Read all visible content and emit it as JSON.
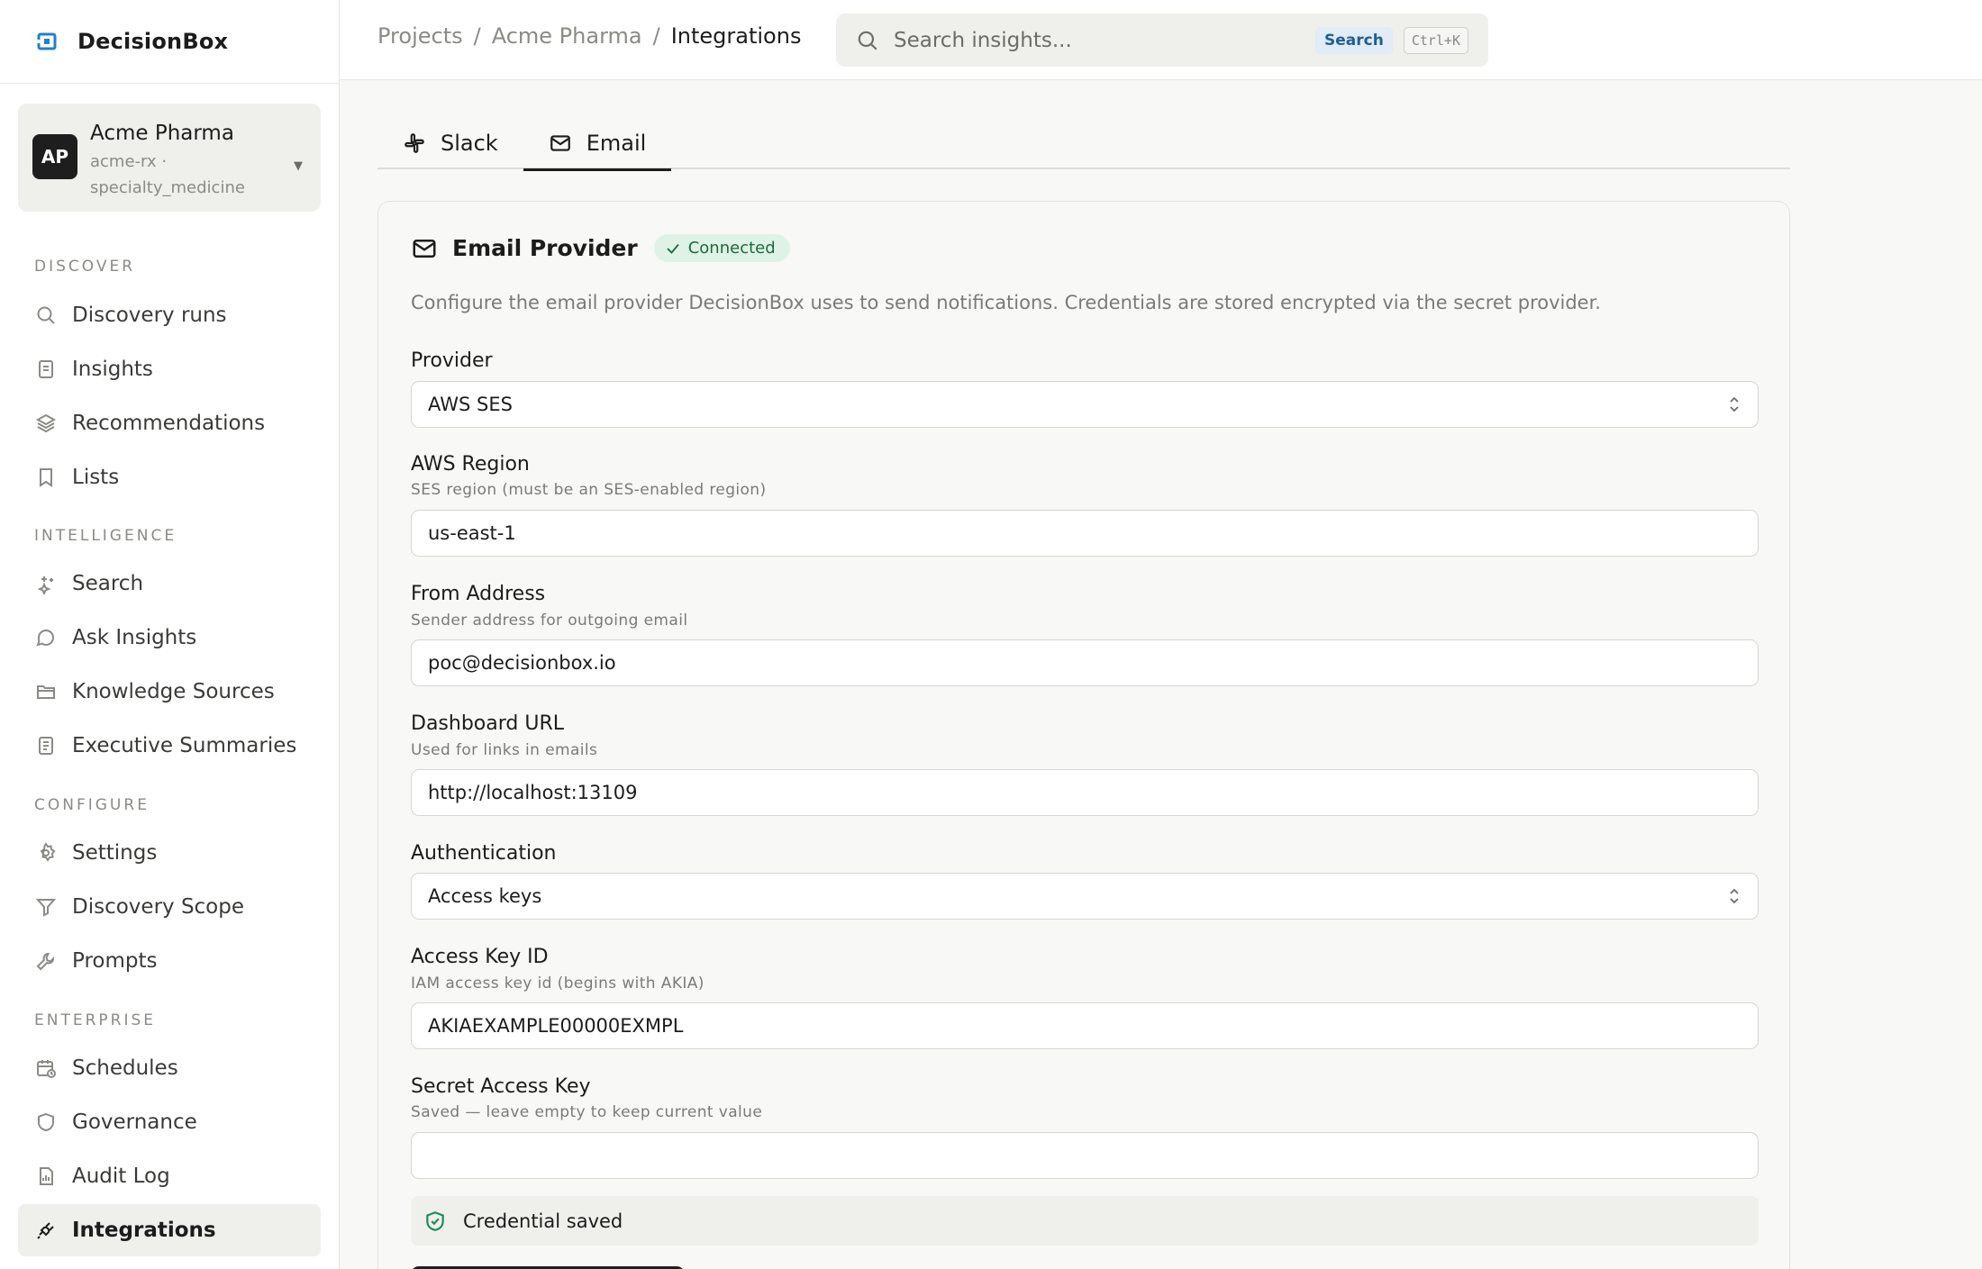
{
  "app": {
    "name": "DecisionBox"
  },
  "project": {
    "initials": "AP",
    "name": "Acme Pharma",
    "subtitle": "acme-rx · specialty_medicine"
  },
  "sidebar": {
    "sections": [
      {
        "title": "DISCOVER",
        "items": [
          "Discovery runs",
          "Insights",
          "Recommendations",
          "Lists"
        ]
      },
      {
        "title": "INTELLIGENCE",
        "items": [
          "Search",
          "Ask Insights",
          "Knowledge Sources",
          "Executive Summaries"
        ]
      },
      {
        "title": "CONFIGURE",
        "items": [
          "Settings",
          "Discovery Scope",
          "Prompts"
        ]
      },
      {
        "title": "ENTERPRISE",
        "items": [
          "Schedules",
          "Governance",
          "Audit Log",
          "Integrations"
        ]
      }
    ],
    "active": "Integrations"
  },
  "breadcrumb": {
    "items": [
      "Projects",
      "Acme Pharma"
    ],
    "current": "Integrations",
    "separator": "/"
  },
  "search": {
    "placeholder": "Search insights...",
    "button": "Search",
    "shortcut": "Ctrl+K"
  },
  "tabs": [
    {
      "label": "Slack",
      "icon": "slack-icon"
    },
    {
      "label": "Email",
      "icon": "mail-icon",
      "active": true
    }
  ],
  "card": {
    "title": "Email Provider",
    "status": "Connected",
    "description": "Configure the email provider DecisionBox uses to send notifications. Credentials are stored encrypted via the secret provider.",
    "fields": {
      "provider": {
        "label": "Provider",
        "value": "AWS SES"
      },
      "region": {
        "label": "AWS Region",
        "hint": "SES region (must be an SES-enabled region)",
        "value": "us-east-1"
      },
      "from": {
        "label": "From Address",
        "hint": "Sender address for outgoing email",
        "value": "poc@decisionbox.io"
      },
      "dashboard": {
        "label": "Dashboard URL",
        "hint": "Used for links in emails",
        "value": "http://localhost:13109"
      },
      "auth": {
        "label": "Authentication",
        "value": "Access keys"
      },
      "access_key": {
        "label": "Access Key ID",
        "hint": "IAM access key id (begins with AKIA)",
        "value": "AKIAEXAMPLE00000EXMPL"
      },
      "secret_key": {
        "label": "Secret Access Key",
        "hint": "Saved — leave empty to keep current value",
        "value": ""
      }
    },
    "saved_message": "Credential saved"
  },
  "colors": {
    "accent": "#1f5e96",
    "connected_bg": "#dff2e6",
    "connected_fg": "#1d6b3c",
    "logo": "#1f7fd1",
    "dark": "#1e1e1e"
  }
}
